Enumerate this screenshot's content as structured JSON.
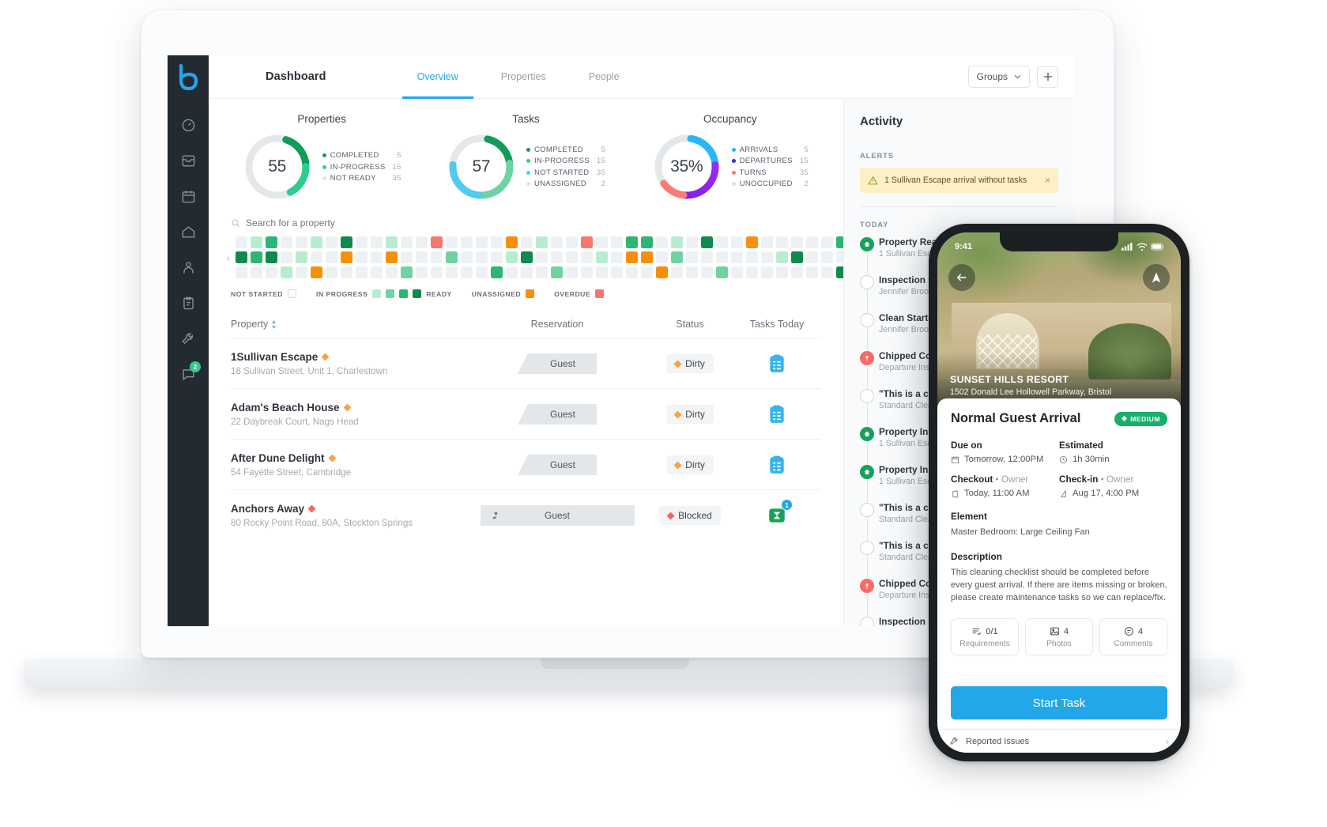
{
  "app": {
    "logo": "breezeway-logo-icon",
    "title": "Dashboard",
    "tabs": [
      {
        "label": "Overview",
        "active": true
      },
      {
        "label": "Properties",
        "active": false
      },
      {
        "label": "People",
        "active": false
      }
    ],
    "groups_label": "Groups",
    "add_label": "+",
    "sidebar_icons": [
      {
        "name": "speedometer-icon",
        "badge": ""
      },
      {
        "name": "inbox-icon",
        "badge": ""
      },
      {
        "name": "calendar-icon",
        "badge": ""
      },
      {
        "name": "home-icon",
        "badge": ""
      },
      {
        "name": "person-task-icon",
        "badge": ""
      },
      {
        "name": "clipboard-icon",
        "badge": ""
      },
      {
        "name": "wrench-icon",
        "badge": ""
      },
      {
        "name": "chat-icon",
        "badge": "2"
      }
    ]
  },
  "chart_data": [
    {
      "type": "pie",
      "title": "Properties",
      "center_value": "55",
      "categories": [
        "COMPLETED",
        "IN-PROGRESS",
        "NOT READY"
      ],
      "values": [
        5,
        15,
        35
      ],
      "colors": [
        "#0f9d58",
        "#2ecc8b",
        "#dfe3e7"
      ],
      "legend": "right"
    },
    {
      "type": "pie",
      "title": "Tasks",
      "center_value": "57",
      "categories": [
        "COMPLETED",
        "IN-PROGRESS",
        "NOT STARTED",
        "UNASSIGNED"
      ],
      "values": [
        5,
        15,
        35,
        2
      ],
      "colors": [
        "#0f9d58",
        "#6fd3a1",
        "#4ecbf0",
        "#dfe3e7"
      ],
      "legend": "right"
    },
    {
      "type": "pie",
      "title": "Occupancy",
      "center_value": "35%",
      "categories": [
        "ARRIVALS",
        "DEPARTURES",
        "TURNS",
        "UNOCCUPIED"
      ],
      "values": [
        5,
        15,
        35,
        2
      ],
      "colors": [
        "#29b6f6",
        "#7b17e8",
        "#fb7a74",
        "#dfe3e7"
      ],
      "legend": "right"
    }
  ],
  "search": {
    "placeholder": "Search for a property",
    "value": ""
  },
  "grid_legend": [
    {
      "label": "NOT STARTED",
      "color": "#ffffff"
    },
    {
      "label": "IN PROGRESS",
      "color": ""
    },
    {
      "label": "READY",
      "color": ""
    },
    {
      "label": "UNASSIGNED",
      "color": "#f79009"
    },
    {
      "label": "OVERDUE",
      "color": "#f8766d"
    }
  ],
  "grid_legend_swatches": {
    "in_progress": [
      "#b8ecd0",
      "#6fd3a1",
      "#2bb673",
      "#0f8a4d"
    ],
    "unassigned": "#f79009",
    "overdue": "#f8766d"
  },
  "table": {
    "columns": [
      "Property",
      "Reservation",
      "Status",
      "Tasks Today"
    ],
    "rows": [
      {
        "name": "1Sullivan Escape",
        "flag_color": "#f7a440",
        "address": "18 Sullivan Street, Unit 1, Charlestown",
        "reservation": "Guest",
        "reservation_style": "slanted",
        "status": "Dirty",
        "status_color": "#f7a440",
        "task_icon": "clipboard-icon",
        "task_icon_color": "#34b4f0",
        "task_badge": ""
      },
      {
        "name": "Adam's Beach House",
        "flag_color": "#f7a440",
        "address": "22 Daybreak Court, Nags Head",
        "reservation": "Guest",
        "reservation_style": "slanted",
        "status": "Dirty",
        "status_color": "#f7a440",
        "task_icon": "clipboard-icon",
        "task_icon_color": "#34b4f0",
        "task_badge": ""
      },
      {
        "name": "After Dune Delight",
        "flag_color": "#f7a440",
        "address": "54 Fayette Street, Cambridge",
        "reservation": "Guest",
        "reservation_style": "slanted",
        "status": "Dirty",
        "status_color": "#f7a440",
        "task_icon": "clipboard-icon",
        "task_icon_color": "#34b4f0",
        "task_badge": ""
      },
      {
        "name": "Anchors Away",
        "flag_color": "#f8635c",
        "address": "80 Rocky Point Road, 80A, Stockton Springs",
        "reservation": "Guest",
        "reservation_style": "boxed",
        "status": "Blocked",
        "status_color": "#f8635c",
        "task_icon": "inspection-icon",
        "task_icon_color": "#1aa05a",
        "task_badge": "1"
      }
    ]
  },
  "activity": {
    "title": "Activity",
    "alerts_label": "ALERTS",
    "alert": {
      "icon": "warning-icon",
      "text": "1 Sullivan Escape arrival without tasks",
      "close": "×"
    },
    "today_label": "TODAY",
    "items": [
      {
        "title": "Property Ready",
        "subtitle": "1 Sullivan Escape",
        "marker": "home-filled",
        "color": "#1aa05a"
      },
      {
        "title": "Inspection Complete",
        "subtitle": "Jennifer Brooks",
        "marker": "hollow",
        "color": ""
      },
      {
        "title": "Clean Started",
        "subtitle": "Jennifer Brooks",
        "marker": "hollow",
        "color": ""
      },
      {
        "title": "Chipped Countertop",
        "subtitle": "Departure Inspection",
        "marker": "issue-filled",
        "color": "#fb6b66"
      },
      {
        "title": "\"This is a comment\"",
        "subtitle": "Standard Clean",
        "marker": "hollow",
        "color": ""
      },
      {
        "title": "Property In Progress",
        "subtitle": "1 Sullivan Escape",
        "marker": "home-filled",
        "color": "#1aa05a"
      },
      {
        "title": "Property In Progress",
        "subtitle": "1 Sullivan Escape",
        "marker": "home-filled",
        "color": "#1aa05a"
      },
      {
        "title": "\"This is a comment\"",
        "subtitle": "Standard Clean",
        "marker": "hollow",
        "color": ""
      },
      {
        "title": "\"This is a comment\"",
        "subtitle": "Standard Clean",
        "marker": "hollow",
        "color": ""
      },
      {
        "title": "Chipped Countertop",
        "subtitle": "Departure Inspection",
        "marker": "issue-filled",
        "color": "#fb6b66"
      },
      {
        "title": "Inspection Complete",
        "subtitle": "Jennifer Brooks",
        "marker": "hollow",
        "color": ""
      }
    ]
  },
  "phone": {
    "status_time": "9:41",
    "back_icon": "back-arrow-icon",
    "nav_icon": "navigate-icon",
    "property_name": "SUNSET HILLS RESORT",
    "property_address": "1502 Donald Lee Hollowell Parkway, Bristol",
    "task_title": "Normal Guest Arrival",
    "priority": "MEDIUM",
    "fields": [
      {
        "label": "Due on",
        "value": "Tomorrow, 12:00PM",
        "icon": "calendar-icon"
      },
      {
        "label": "Estimated",
        "value": "1h 30min",
        "icon": "clock-icon"
      },
      {
        "label": "Checkout",
        "sub": "• Owner",
        "value": "Today, 11:00 AM",
        "icon": "checkout-icon"
      },
      {
        "label": "Check-in",
        "sub": "• Owner",
        "value": "Aug 17, 4:00 PM",
        "icon": "checkin-icon"
      }
    ],
    "element_label": "Element",
    "element_value": "Master Bedroom: Large Ceiling Fan",
    "description_label": "Description",
    "description_value": "This cleaning checklist should be completed before every guest arrival. If there are items missing or broken, please create maintenance tasks so we can replace/fix.",
    "stats": [
      {
        "value": "0/1",
        "label": "Requirements",
        "icon": "requirements-icon"
      },
      {
        "value": "4",
        "label": "Photos",
        "icon": "photo-icon"
      },
      {
        "value": "4",
        "label": "Comments",
        "icon": "comment-icon"
      }
    ],
    "cta_label": "Start Task",
    "footer_label": "Reported Issues",
    "footer_icon": "wrench-icon"
  }
}
